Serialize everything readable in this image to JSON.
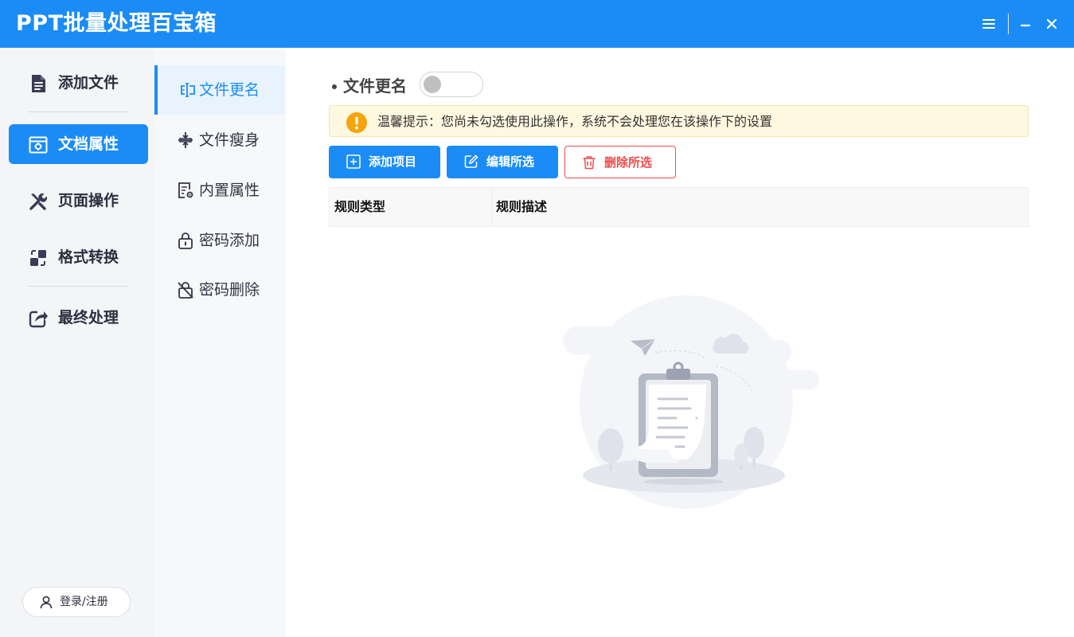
{
  "app": {
    "title": "PPT批量处理百宝箱"
  },
  "window_controls": {
    "menu": "menu-icon",
    "minimize": "minimize-icon",
    "close": "close-icon"
  },
  "sidebar": {
    "items": [
      {
        "label": "添加文件",
        "icon": "file-add-icon",
        "active": false
      },
      {
        "label": "文档属性",
        "icon": "document-settings-icon",
        "active": true
      },
      {
        "label": "页面操作",
        "icon": "tools-icon",
        "active": false
      },
      {
        "label": "格式转换",
        "icon": "convert-icon",
        "active": false
      },
      {
        "label": "最终处理",
        "icon": "share-export-icon",
        "active": false
      }
    ],
    "login_label": "登录/注册"
  },
  "submenu": {
    "items": [
      {
        "label": "文件更名",
        "icon": "rename-icon",
        "active": true
      },
      {
        "label": "文件瘦身",
        "icon": "compress-icon",
        "active": false
      },
      {
        "label": "内置属性",
        "icon": "properties-icon",
        "active": false
      },
      {
        "label": "密码添加",
        "icon": "lock-icon",
        "active": false
      },
      {
        "label": "密码删除",
        "icon": "unlock-icon",
        "active": false
      }
    ]
  },
  "main": {
    "section_title": "文件更名",
    "toggle_on": false,
    "notice": "温馨提示：您尚未勾选使用此操作，系统不会处理您在该操作下的设置",
    "buttons": {
      "add": "添加项目",
      "edit": "编辑所选",
      "delete": "删除所选"
    },
    "table": {
      "columns": [
        "规则类型",
        "规则描述"
      ],
      "rows": []
    }
  },
  "colors": {
    "primary": "#1b8cf6",
    "danger": "#ef4a4a",
    "notice_bg": "#fff8e1",
    "notice_icon": "#f7a30a",
    "sidebar_bg": "#f4f5f7"
  }
}
